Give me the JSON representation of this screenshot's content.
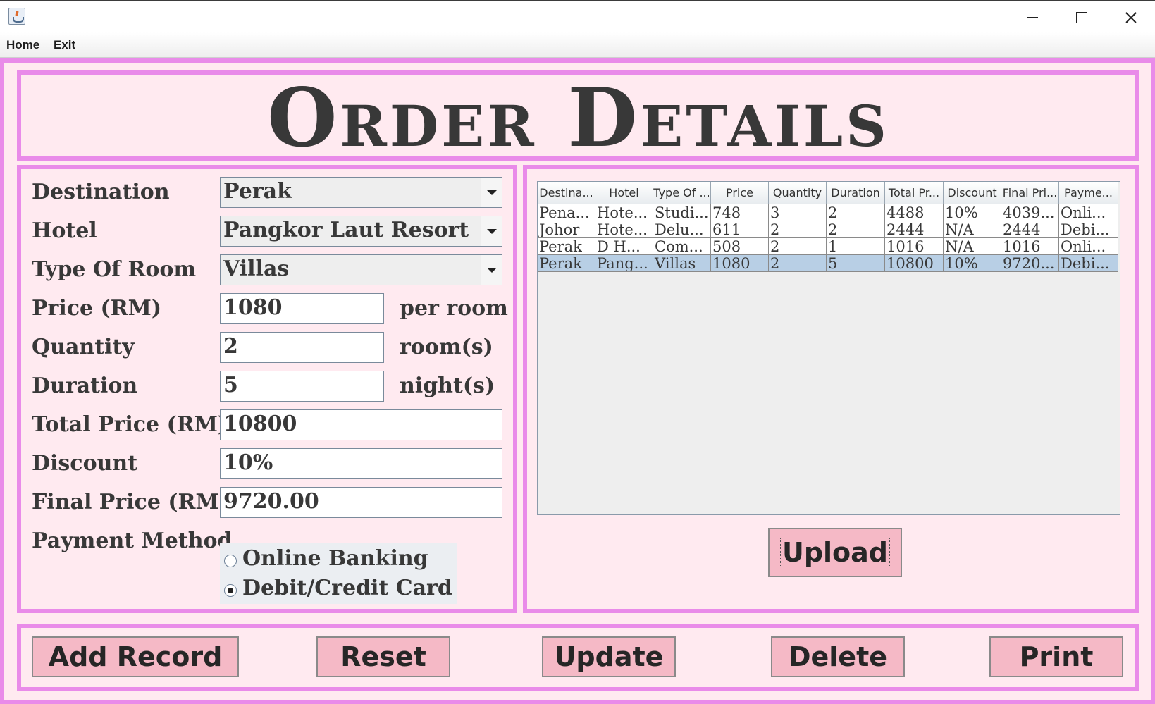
{
  "menu": {
    "home": "Home",
    "exit": "Exit"
  },
  "title": "Order Details",
  "form": {
    "destination_label": "Destination",
    "destination_value": "Perak",
    "hotel_label": "Hotel",
    "hotel_value": "Pangkor Laut Resort",
    "room_type_label": "Type Of Room",
    "room_type_value": "Villas",
    "price_label": "Price (RM)",
    "price_value": "1080",
    "price_unit": "per room",
    "quantity_label": "Quantity",
    "quantity_value": "2",
    "quantity_unit": "room(s)",
    "duration_label": "Duration",
    "duration_value": "5",
    "duration_unit": "night(s)",
    "total_label": "Total Price (RM)",
    "total_value": "10800",
    "discount_label": "Discount",
    "discount_value": "10%",
    "final_label": "Final Price (RM)",
    "final_value": "9720.00",
    "payment_label": "Payment Method",
    "payment_options": [
      "Online Banking",
      "Debit/Credit Card"
    ],
    "payment_selected": "Debit/Credit Card"
  },
  "table": {
    "columns": [
      "Destina...",
      "Hotel",
      "Type Of ...",
      "Price",
      "Quantity",
      "Duration",
      "Total Pr...",
      "Discount",
      "Final Pri...",
      "Payme..."
    ],
    "rows": [
      [
        "Pena...",
        "Hote...",
        "Studi...",
        "748",
        "3",
        "2",
        "4488",
        "10%",
        "4039...",
        "Onli..."
      ],
      [
        "Johor",
        "Hote...",
        "Delu...",
        "611",
        "2",
        "2",
        "2444",
        "N/A",
        "2444",
        "Debi..."
      ],
      [
        "Perak",
        "D H...",
        "Com...",
        "508",
        "2",
        "1",
        "1016",
        "N/A",
        "1016",
        "Onli..."
      ],
      [
        "Perak",
        "Pang...",
        "Villas",
        "1080",
        "2",
        "5",
        "10800",
        "10%",
        "9720...",
        "Debi..."
      ]
    ],
    "selected_row": 3
  },
  "buttons": {
    "upload": "Upload",
    "add": "Add Record",
    "reset": "Reset",
    "update": "Update",
    "delete": "Delete",
    "print": "Print"
  },
  "colors": {
    "border": "#e98be9",
    "panel": "#ffeaf0",
    "button": "#f5b9c6",
    "selection": "#b8cfe5"
  }
}
